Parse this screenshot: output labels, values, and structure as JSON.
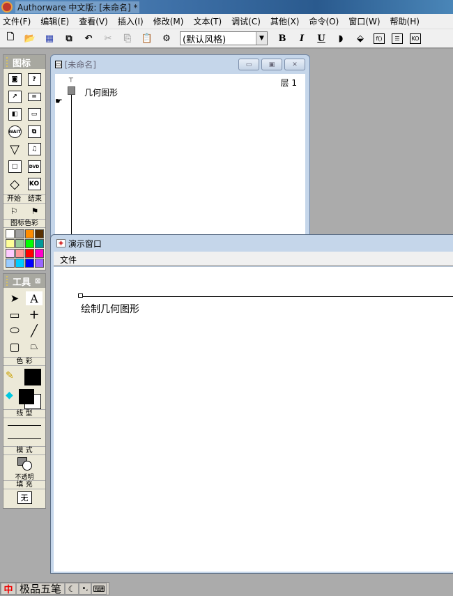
{
  "app": {
    "title": "Authorware 中文版: [未命名] *"
  },
  "menu": [
    "文件(F)",
    "编辑(E)",
    "查看(V)",
    "插入(I)",
    "修改(M)",
    "文本(T)",
    "调试(C)",
    "其他(X)",
    "命令(O)",
    "窗口(W)",
    "帮助(H)"
  ],
  "toolbar": {
    "style_value": "(默认风格)",
    "bold": "B",
    "italic": "I",
    "underline": "U"
  },
  "icon_palette": {
    "title": "图标",
    "start_end": [
      "开始",
      "结束"
    ],
    "color_label": "图标色彩",
    "icon_colors": [
      "#ffffff",
      "#a0a0a0",
      "#ff8c00",
      "#5a3000",
      "#ffff99",
      "#99cc99",
      "#00ff00",
      "#009999",
      "#ffccff",
      "#ff9999",
      "#ff0000",
      "#ff00cc",
      "#99ccff",
      "#00ccff",
      "#0000ff",
      "#9966ff"
    ]
  },
  "tools_palette": {
    "title": "工具",
    "text_tool": "A",
    "color_label": "色 彩",
    "line_label": "线 型",
    "mode_label": "模 式",
    "mode_value": "不透明",
    "fill_label": "填 充",
    "fill_value": "无"
  },
  "flow_window": {
    "title": "[未命名]",
    "level": "层 1",
    "icon_label": "几何图形"
  },
  "presentation_window": {
    "title": "演示窗口",
    "menu_file": "文件",
    "text": "绘制几何图形"
  },
  "ime": {
    "logo": "中",
    "name": "极品五笔"
  }
}
